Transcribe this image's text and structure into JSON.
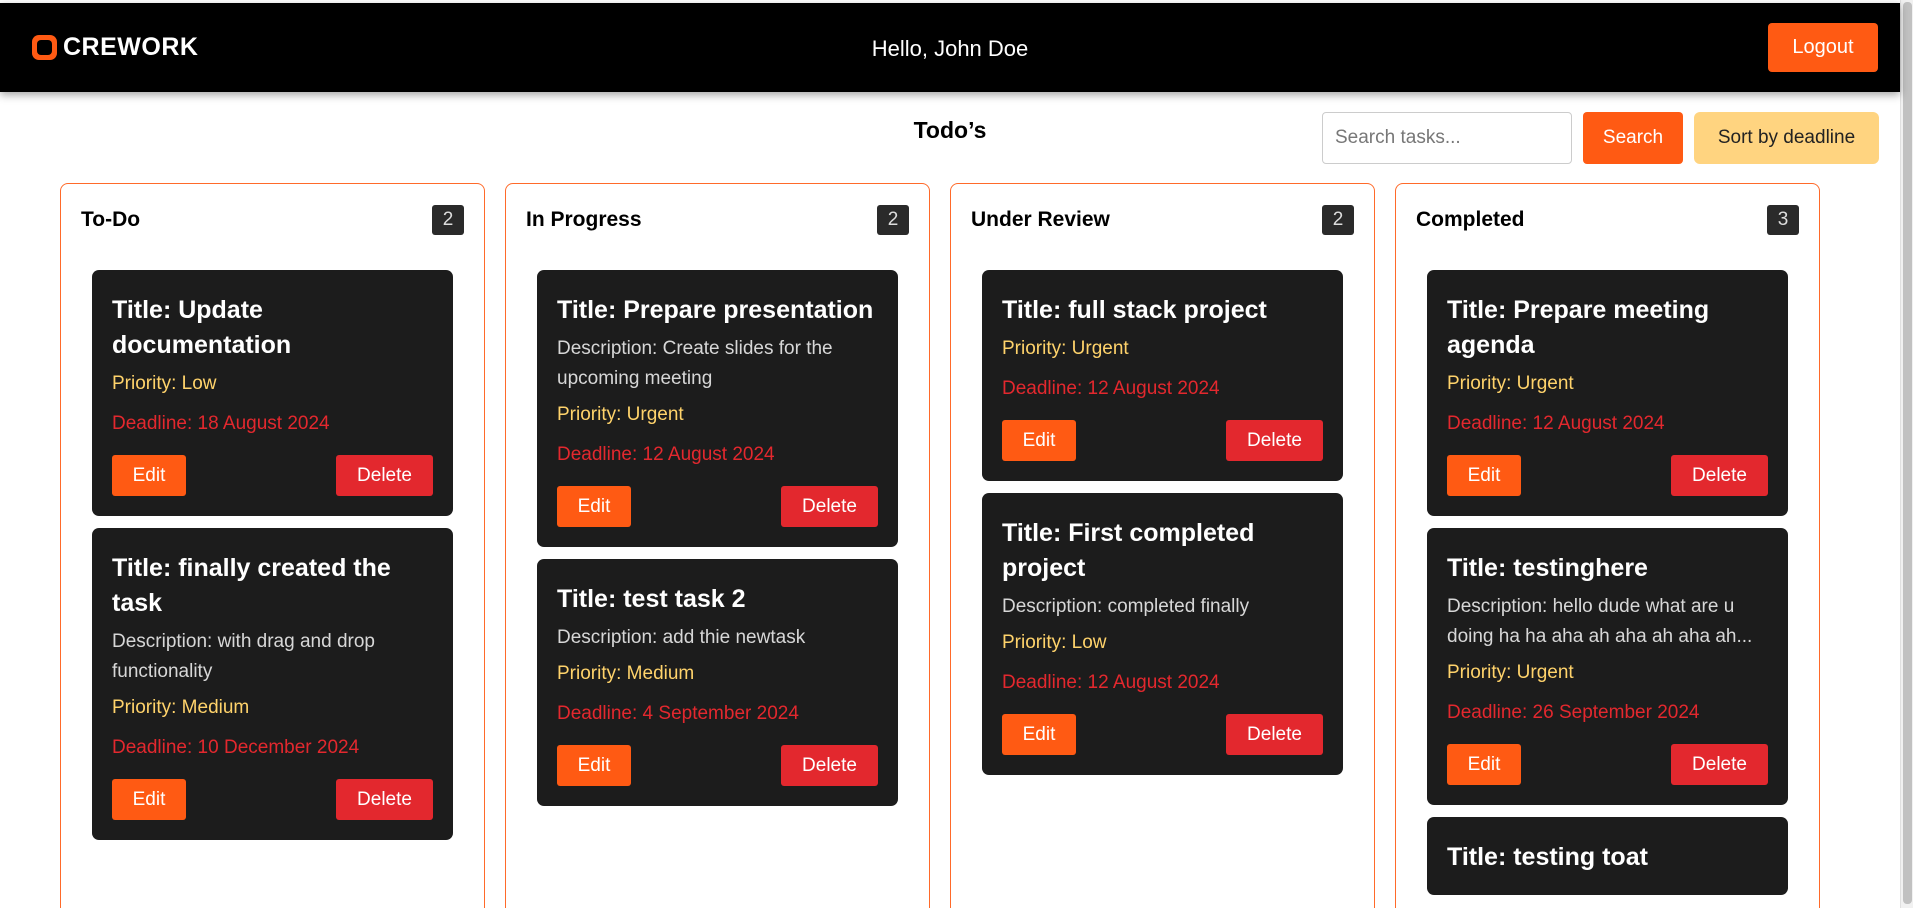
{
  "header": {
    "brand": "CREWORK",
    "greeting": "Hello, John Doe",
    "logout_label": "Logout"
  },
  "main": {
    "title": "Todo’s",
    "search_placeholder": "Search tasks...",
    "search_label": "Search",
    "sort_label": "Sort by deadline"
  },
  "columns": [
    {
      "title": "To-Do",
      "count": "2",
      "cards": [
        {
          "title": "Title: Update documentation",
          "description": "",
          "priority": "Priority: Low",
          "deadline": "Deadline: 18 August 2024",
          "edit": "Edit",
          "delete": "Delete"
        },
        {
          "title": "Title: finally created the task",
          "description": "Description: with drag and drop functionality",
          "priority": "Priority: Medium",
          "deadline": "Deadline: 10 December 2024",
          "edit": "Edit",
          "delete": "Delete"
        }
      ]
    },
    {
      "title": "In Progress",
      "count": "2",
      "cards": [
        {
          "title": "Title: Prepare presentation",
          "description": "Description: Create slides for the upcoming meeting",
          "priority": "Priority: Urgent",
          "deadline": "Deadline: 12 August 2024",
          "edit": "Edit",
          "delete": "Delete"
        },
        {
          "title": "Title: test task 2",
          "description": "Description: add thie newtask",
          "priority": "Priority: Medium",
          "deadline": "Deadline: 4 September 2024",
          "edit": "Edit",
          "delete": "Delete"
        }
      ]
    },
    {
      "title": "Under Review",
      "count": "2",
      "cards": [
        {
          "title": "Title: full stack project",
          "description": "",
          "priority": "Priority: Urgent",
          "deadline": "Deadline: 12 August 2024",
          "edit": "Edit",
          "delete": "Delete"
        },
        {
          "title": "Title: First completed project",
          "description": "Description: completed finally",
          "priority": "Priority: Low",
          "deadline": "Deadline: 12 August 2024",
          "edit": "Edit",
          "delete": "Delete"
        }
      ]
    },
    {
      "title": "Completed",
      "count": "3",
      "cards": [
        {
          "title": "Title: Prepare meeting agenda",
          "description": "",
          "priority": "Priority: Urgent",
          "deadline": "Deadline: 12 August 2024",
          "edit": "Edit",
          "delete": "Delete"
        },
        {
          "title": "Title: testinghere",
          "description": "Description: hello dude what are u doing ha ha aha ah aha ah aha ah...",
          "priority": "Priority: Urgent",
          "deadline": "Deadline: 26 September 2024",
          "edit": "Edit",
          "delete": "Delete"
        },
        {
          "title": "Title: testing toat",
          "description": "",
          "priority": "",
          "deadline": "",
          "edit": "",
          "delete": ""
        }
      ]
    }
  ],
  "colors": {
    "accent": "#ff5a13",
    "danger": "#e3282e",
    "priority": "#ffd36b",
    "card_bg": "#1c1c1c",
    "sort_bg": "#ffd480"
  }
}
